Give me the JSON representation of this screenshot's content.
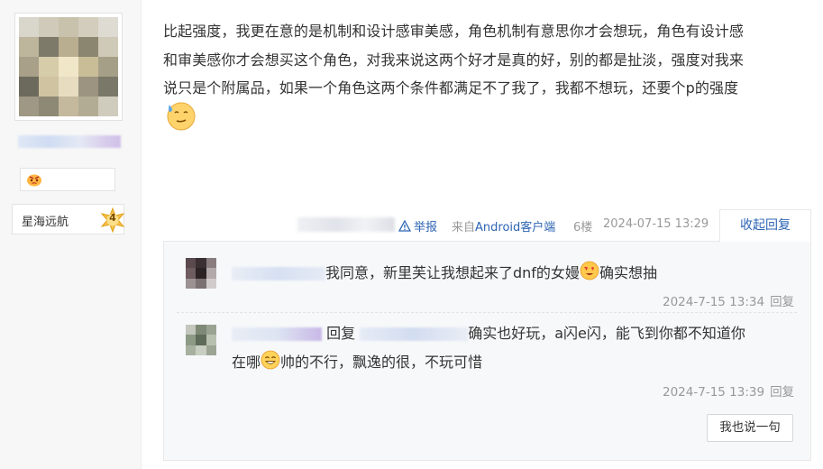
{
  "user": {
    "level_name": "星海远航",
    "level_number": "4"
  },
  "post": {
    "lines": [
      "比起强度，我更在意的是机制和设计感审美感，角色机制有意思你才会想玩，角色有设计感",
      "和审美感你才会想买这个角色，对我来说这两个好才是真的好，别的都是扯淡，强度对我来",
      "说只是个附属品，如果一个角色这两个条件都满足不了我了，我都不想玩，还要个p的强度"
    ],
    "emoji": "sweat-smile-emoji"
  },
  "meta": {
    "report_label": "举报",
    "from_prefix": "来自",
    "from_client": "Android客户端",
    "floor": "6楼",
    "time": "2024-07-15 13:29",
    "collapse_label": "收起回复"
  },
  "replies": [
    {
      "text_before": "我同意，新里芙让我想起来了dnf的女嫚",
      "text_after": "确实想抽",
      "emoji": "heart-eyes-emoji",
      "time": "2024-7-15 13:34",
      "reply_label": "回复"
    },
    {
      "reply_word": "回复",
      "line1_after": "确实也好玩，a闪e闪，能飞到你都不知道你",
      "line2_before": "在哪",
      "line2_after": "帅的不行，飘逸的很，不玩可惜",
      "emoji": "grin-emoji",
      "time": "2024-7-15 13:39",
      "reply_label": "回复"
    }
  ],
  "say_button_label": "我也说一句",
  "colors": {
    "link_blue": "#2d64b3",
    "meta_gray": "#999999",
    "text": "#333333"
  }
}
